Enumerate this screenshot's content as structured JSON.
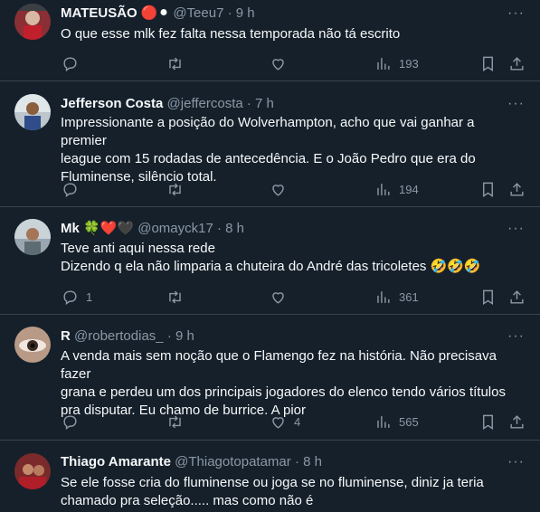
{
  "tweets": [
    {
      "name": "MATEUSÃO",
      "name_suffix": "🔴⚫",
      "handle": "@Teeu7",
      "time": "9 h",
      "lines": [
        "O que esse mlk fez falta nessa temporada não tá escrito"
      ],
      "replies": "",
      "retweets": "",
      "likes": "",
      "views": "193"
    },
    {
      "name": "Jefferson Costa",
      "name_suffix": "",
      "handle": "@jeffercosta",
      "time": "7 h",
      "lines": [
        "Impressionante a posição do Wolverhampton, acho que vai ganhar a premier",
        "league com 15 rodadas de antecedência. E o João Pedro que era do",
        "Fluminense, silêncio total."
      ],
      "replies": "",
      "retweets": "",
      "likes": "",
      "views": "194"
    },
    {
      "name": "Mk",
      "name_suffix": "🍀❤️🖤",
      "handle": "@omayck17",
      "time": "8 h",
      "lines": [
        "Teve anti aqui nessa rede",
        "Dizendo q ela não limparia a chuteira do André das tricoletes 🤣🤣🤣"
      ],
      "replies": "1",
      "retweets": "",
      "likes": "",
      "views": "361"
    },
    {
      "name": "R",
      "name_suffix": "",
      "handle": "@robertodias_",
      "time": "9 h",
      "lines": [
        "A venda mais sem noção que o Flamengo fez na história. Não precisava fazer",
        "grana e perdeu um dos principais jogadores do elenco tendo vários títulos",
        "pra disputar. Eu chamo de burrice. A pior"
      ],
      "replies": "",
      "retweets": "",
      "likes": "4",
      "views": "565"
    },
    {
      "name": "Thiago Amarante",
      "name_suffix": "",
      "handle": "@Thiagotopatamar",
      "time": "8 h",
      "lines": [
        "Se ele fosse cria do fluminense ou joga se no fluminense,  diniz ja teria",
        "chamado pra seleção..... mas como não é"
      ],
      "replies": "",
      "retweets": "",
      "likes": "",
      "views": ""
    }
  ],
  "icons": {
    "reply": "reply-icon",
    "retweet": "retweet-icon",
    "like": "heart-icon",
    "views": "views-icon",
    "bookmark": "bookmark-icon",
    "share": "share-icon",
    "more": "more-icon"
  },
  "colors": {
    "background": "#15202b",
    "text": "#f7f9f9",
    "secondary": "#8b98a5",
    "divider": "#38444d"
  }
}
